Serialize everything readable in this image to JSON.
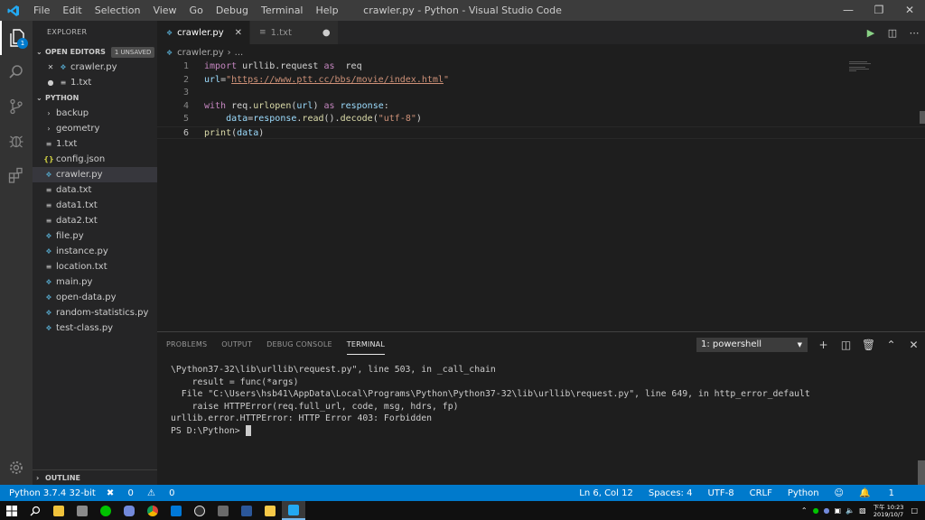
{
  "window": {
    "title": "crawler.py - Python - Visual Studio Code",
    "menu": [
      "File",
      "Edit",
      "Selection",
      "View",
      "Go",
      "Debug",
      "Terminal",
      "Help"
    ]
  },
  "activity_bar": {
    "explorer_badge": "1"
  },
  "sidebar": {
    "title": "EXPLORER",
    "open_editors_label": "OPEN EDITORS",
    "unsaved_label": "1 UNSAVED",
    "open_editors": [
      {
        "name": "crawler.py",
        "icon": "python-file-icon"
      },
      {
        "name": "1.txt",
        "icon": "text-file-icon"
      }
    ],
    "folder_label": "PYTHON",
    "items": [
      {
        "name": "backup",
        "type": "folder"
      },
      {
        "name": "geometry",
        "type": "folder"
      },
      {
        "name": "1.txt",
        "type": "txt"
      },
      {
        "name": "config.json",
        "type": "json"
      },
      {
        "name": "crawler.py",
        "type": "py"
      },
      {
        "name": "data.txt",
        "type": "txt"
      },
      {
        "name": "data1.txt",
        "type": "txt"
      },
      {
        "name": "data2.txt",
        "type": "txt"
      },
      {
        "name": "file.py",
        "type": "py"
      },
      {
        "name": "instance.py",
        "type": "py"
      },
      {
        "name": "location.txt",
        "type": "txt"
      },
      {
        "name": "main.py",
        "type": "py"
      },
      {
        "name": "open-data.py",
        "type": "py"
      },
      {
        "name": "random-statistics.py",
        "type": "py"
      },
      {
        "name": "test-class.py",
        "type": "py"
      }
    ],
    "outline_label": "OUTLINE"
  },
  "tabs": [
    {
      "label": "crawler.py",
      "active": true
    },
    {
      "label": "1.txt",
      "active": false
    }
  ],
  "breadcrumb": {
    "file": "crawler.py",
    "separator": "›",
    "rest": "..."
  },
  "editor": {
    "line_numbers": [
      "1",
      "2",
      "3",
      "4",
      "5",
      "6"
    ]
  },
  "panel": {
    "tabs": [
      "PROBLEMS",
      "OUTPUT",
      "DEBUG CONSOLE",
      "TERMINAL"
    ],
    "terminal_select": "1: powershell",
    "terminal_lines": [
      "\\Python37-32\\lib\\urllib\\request.py\", line 503, in _call_chain",
      "    result = func(*args)",
      "  File \"C:\\Users\\hsb41\\AppData\\Local\\Programs\\Python\\Python37-32\\lib\\urllib\\request.py\", line 649, in http_error_default",
      "    raise HTTPError(req.full_url, code, msg, hdrs, fp)",
      "urllib.error.HTTPError: HTTP Error 403: Forbidden"
    ],
    "prompt": "PS D:\\Python> "
  },
  "status_bar": {
    "python": "Python 3.7.4 32-bit",
    "errors": "0",
    "warnings": "0",
    "position": "Ln 6, Col 12",
    "spaces": "Spaces: 4",
    "encoding": "UTF-8",
    "eol": "CRLF",
    "language": "Python",
    "notifications": "1"
  },
  "taskbar": {
    "clock_time": "下午 10:23",
    "clock_date": "2019/10/7"
  },
  "colors": {
    "accent": "#007acc",
    "keyword": "#c586c0",
    "string": "#ce9178",
    "function": "#dcdcaa"
  }
}
